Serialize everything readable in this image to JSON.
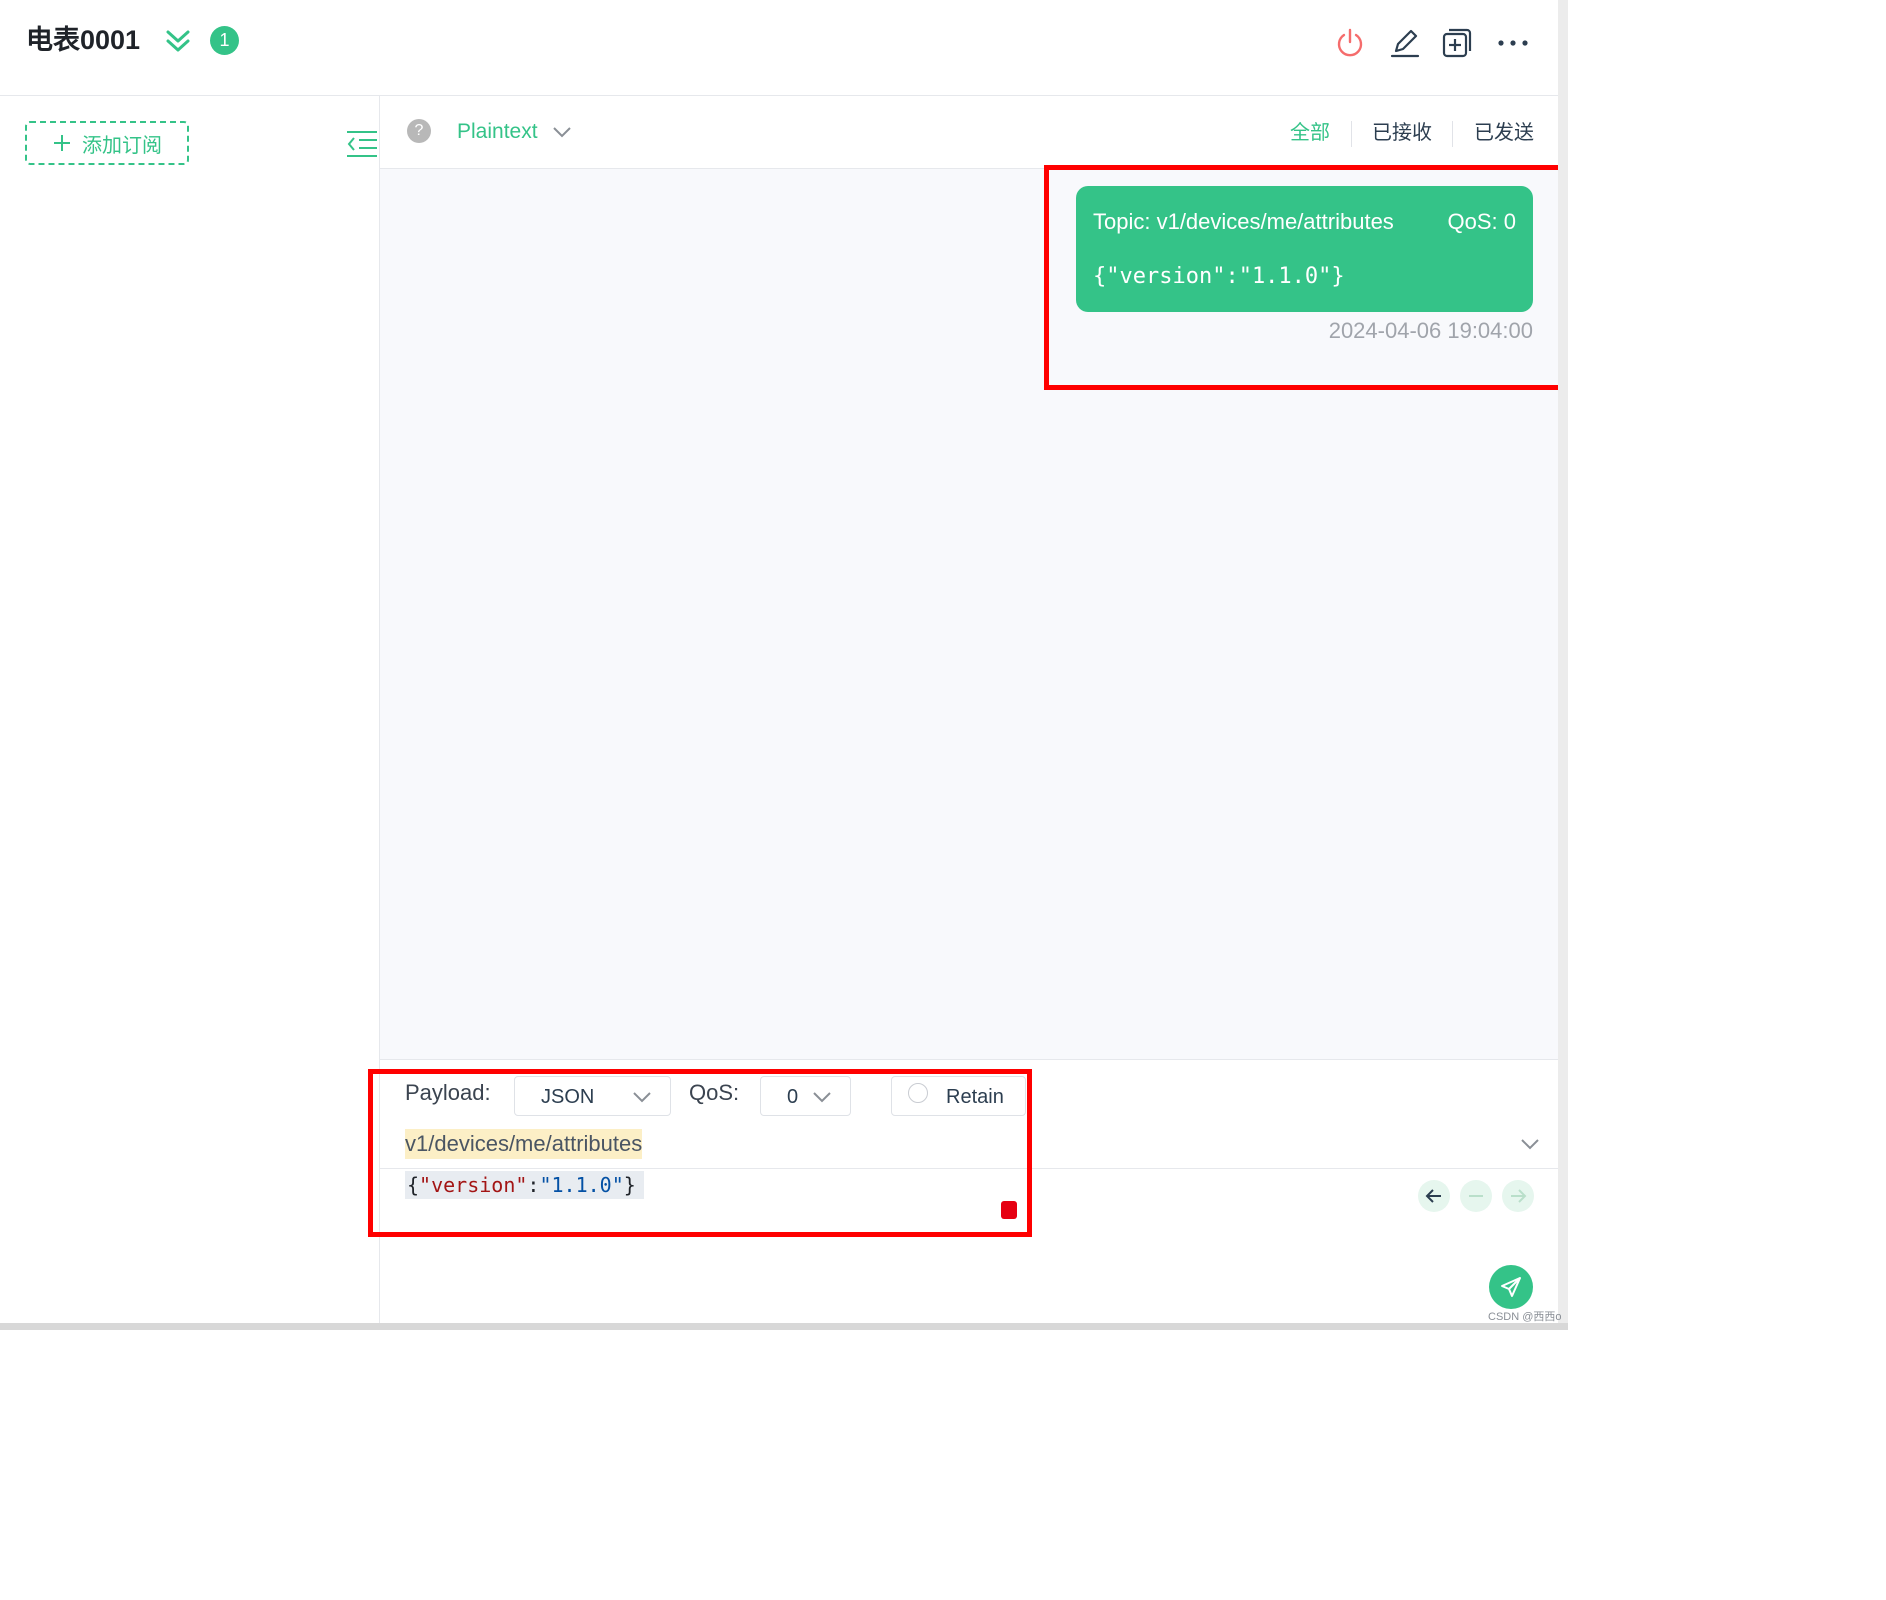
{
  "header": {
    "title": "电表0001",
    "badge_count": "1",
    "icons": [
      "power-icon",
      "edit-icon",
      "new-window-icon",
      "more-icon"
    ]
  },
  "sidebar": {
    "add_subscription_label": "添加订阅"
  },
  "toolbar": {
    "help_label": "?",
    "format_value": "Plaintext",
    "filters": [
      "全部",
      "已接收",
      "已发送"
    ],
    "active_filter": "全部"
  },
  "message": {
    "topic": "Topic: v1/devices/me/attributes",
    "qos": "QoS: 0",
    "payload": "{\"version\":\"1.1.0\"}",
    "timestamp": "2024-04-06 19:04:00"
  },
  "compose": {
    "payload_label": "Payload:",
    "payload_format": "JSON",
    "qos_label": "QoS:",
    "qos_value": "0",
    "retain_label": "Retain",
    "topic_value": "v1/devices/me/attributes",
    "payload_open": "{",
    "payload_key": "\"version\"",
    "payload_colon": ":",
    "payload_val": "\"1.1.0\"",
    "payload_close": "}"
  },
  "watermark": "CSDN @西西o",
  "colors": {
    "accent": "#34c388",
    "highlight_border": "#ff0000",
    "power": "#f56c6c"
  }
}
